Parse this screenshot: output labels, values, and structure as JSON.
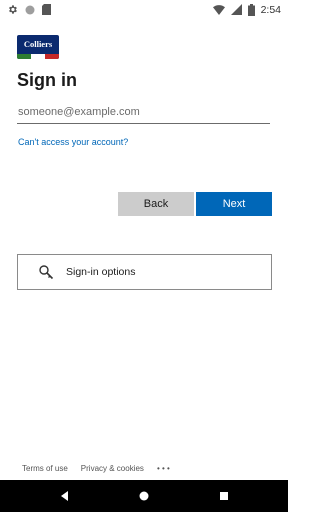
{
  "status_bar": {
    "time": "2:54",
    "left_icons": [
      "gear-icon",
      "circle-icon",
      "sd-card-icon"
    ],
    "right_icons": [
      "wifi-icon",
      "signal-icon",
      "battery-icon"
    ]
  },
  "logo": {
    "text": "Colliers",
    "brand_color": "#0b2a6f",
    "stripe_colors": [
      "#2e7d32",
      "#ffffff",
      "#c62828"
    ]
  },
  "signin": {
    "title": "Sign in",
    "email_placeholder": "someone@example.com",
    "email_value": "",
    "cant_access_link": "Can't access your account?",
    "back_label": "Back",
    "next_label": "Next",
    "accent_color": "#0067b8"
  },
  "options": {
    "label": "Sign-in options",
    "icon": "key-search-icon"
  },
  "footer": {
    "terms": "Terms of use",
    "privacy": "Privacy & cookies",
    "more": "• • •"
  },
  "nav_bar": {
    "buttons": [
      "back-triangle-icon",
      "home-circle-icon",
      "recents-square-icon"
    ]
  }
}
